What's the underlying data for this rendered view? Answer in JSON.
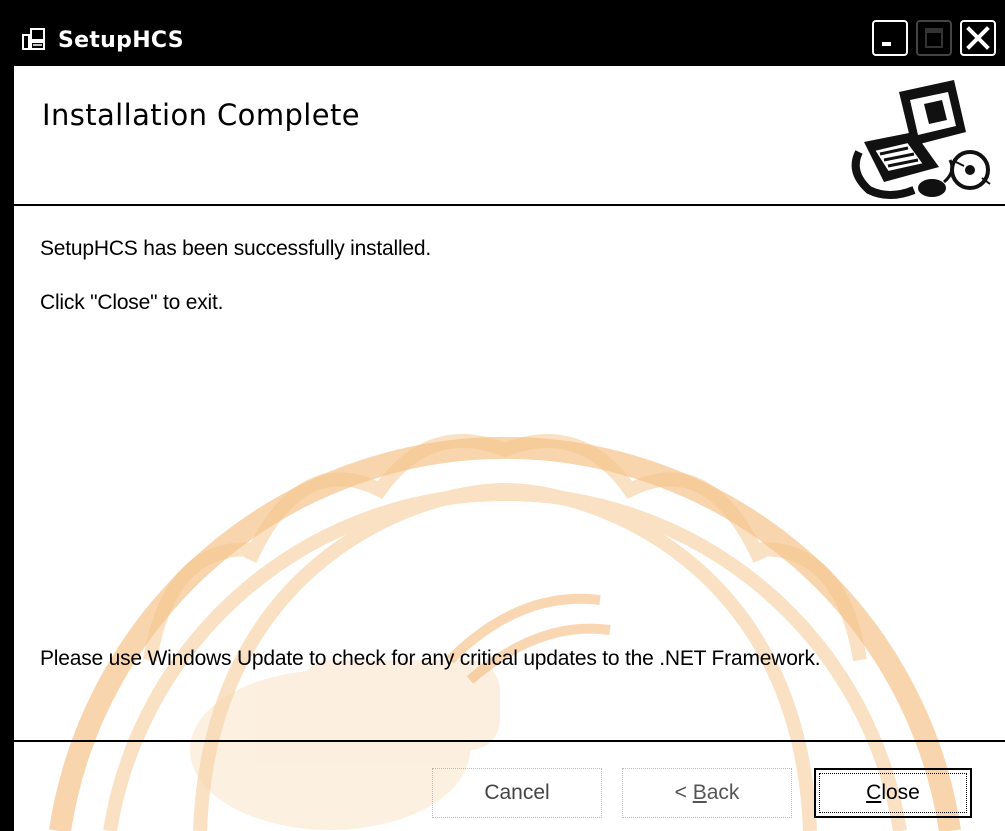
{
  "window": {
    "title": "SetupHCS",
    "controls": {
      "minimize": "minimize",
      "maximize": "maximize",
      "close": "close"
    }
  },
  "header": {
    "title": "Installation Complete",
    "graphic_icon": "computer-install-graphic-icon"
  },
  "body": {
    "line1": "SetupHCS has been successfully installed.",
    "line2": "Click \"Close\" to exit.",
    "line3": "Please use Windows Update to check for any critical updates to the .NET Framework."
  },
  "buttons": {
    "cancel": "Cancel",
    "back_prefix": "< ",
    "back_mnemonic": "B",
    "back_rest": "ack",
    "close_mnemonic": "C",
    "close_rest": "lose"
  },
  "colors": {
    "titlebar": "#000000",
    "watermark": "#f2a34a"
  }
}
